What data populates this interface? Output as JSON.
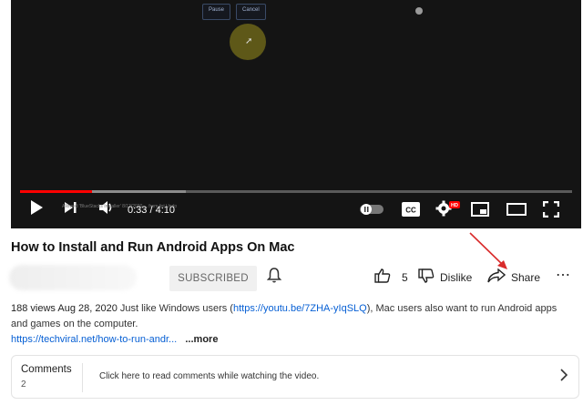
{
  "player": {
    "pause_label": "Pause",
    "cancel_label": "Cancel",
    "caption_text": "Allowed 'BlueStacks Installer' 8/12/2020 ... from list       Undo",
    "time": "0:33 / 4:10",
    "progress_fraction": 0.13,
    "buffered_fraction": 0.3,
    "hd_badge": "HD",
    "cc_label": "CC"
  },
  "video": {
    "title": "How to Install and Run Android Apps On Mac",
    "subscribe_label": "SUBSCRIBED",
    "like_count": "5",
    "dislike_label": "Dislike",
    "share_label": "Share",
    "more_icon": "⋯"
  },
  "description": {
    "stats": "188 views  Aug 28, 2020",
    "text1": "  Just like Windows users (",
    "link1": "https://youtu.be/7ZHA-yIqSLQ",
    "text2": "), Mac users also want to run Android apps and games on the computer.",
    "link2": "https://techviral.net/how-to-run-andr...",
    "more": "...more"
  },
  "comments": {
    "title": "Comments",
    "count": "2",
    "prompt": "Click here to read comments while watching the video."
  },
  "colors": {
    "accent": "#ff0000",
    "link": "#065fd4",
    "annotation_arrow": "#d92b2b"
  }
}
